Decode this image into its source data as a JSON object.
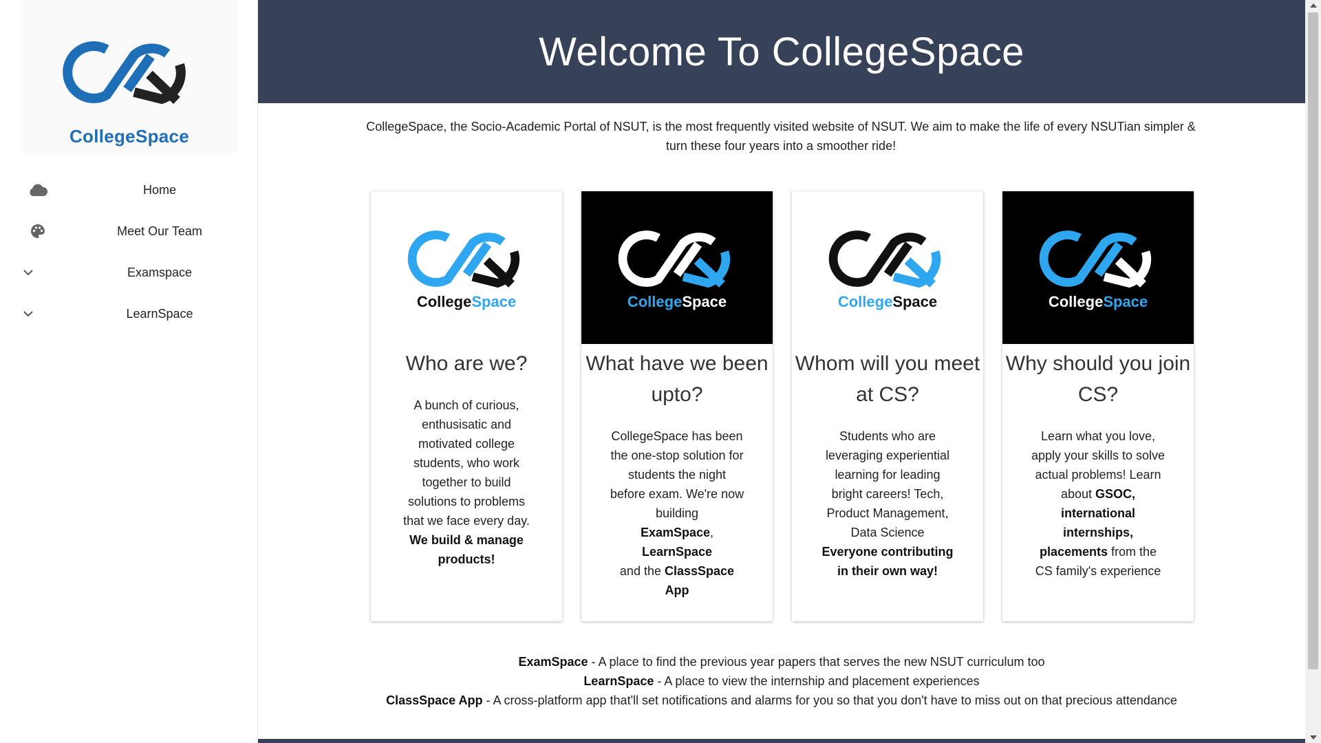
{
  "sidebar": {
    "brand": {
      "part1": "College",
      "part2": "Space"
    },
    "items": [
      {
        "label": "Home",
        "icon": "cloud-icon"
      },
      {
        "label": "Meet Our Team",
        "icon": "palette-icon"
      },
      {
        "label": "Examspace",
        "icon": "chevron-down-icon"
      },
      {
        "label": "LearnSpace",
        "icon": "chevron-down-icon"
      }
    ]
  },
  "hero": {
    "title": "Welcome To CollegeSpace"
  },
  "intro": "CollegeSpace, the Socio-Academic Portal of NSUT, is the most frequently visited website of NSUT. We aim to make the life of every NSUTian simpler & turn these four years into a smoother ride!",
  "cards": [
    {
      "logo_part1": "College",
      "logo_part2": "Space",
      "title": "Who are we?",
      "text": "A bunch of curious, enthusisatic and motivated college students, who work together to build solutions to problems that we face every day.",
      "bold": "We build & manage products!"
    },
    {
      "logo_part1": "College",
      "logo_part2": "Space",
      "title": "What have we been upto?",
      "text": "CollegeSpace has been the one-stop solution for students the night before exam. We're now building",
      "bold1": "ExamSpace",
      "sep": ", ",
      "bold2": "LearnSpace",
      "and": " and the ",
      "bold3": "ClassSpace App"
    },
    {
      "logo_part1": "College",
      "logo_part2": "Space",
      "title": "Whom will you meet at CS?",
      "text": "Students who are leveraging experiential learning for leading bright careers! Tech, Product Management, Data Science",
      "bold": "Everyone contributing in their own way!"
    },
    {
      "logo_part1": "College",
      "logo_part2": "Space",
      "title": "Why should you join CS?",
      "text": "Learn what you love, apply your skills to solve actual problems! Learn about",
      "bold": "GSOC, international internships, placements",
      "tail": "from the CS family's experience"
    }
  ],
  "footer": [
    {
      "name": "ExamSpace",
      "desc": " - A place to find the previous year papers that serves the new NSUT curriculum too"
    },
    {
      "name": "LearnSpace",
      "desc": " - A place to view the internship and placement experiences"
    },
    {
      "name": "ClassSpace App",
      "desc": " - A cross-platform app that'll set notifications and alarms for you so that you don't have to miss out on that precious attendance"
    }
  ],
  "colors": {
    "header": "#374259",
    "accent": "#1e6fb8",
    "logo_light_blue": "#2fa7f0",
    "logo_dark": "#222222"
  }
}
